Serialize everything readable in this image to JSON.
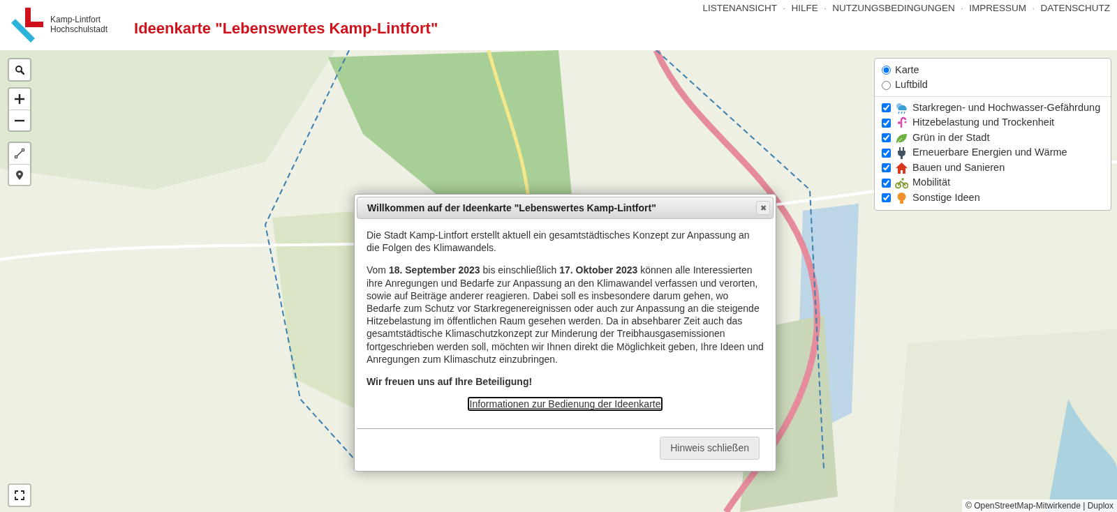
{
  "header": {
    "logo_lines": [
      "Kamp-Lintfort",
      "Hochschulstadt"
    ],
    "title": "Ideenkarte \"Lebenswertes Kamp-Lintfort\"",
    "nav": [
      {
        "kind": "link",
        "text": "LISTENANSICHT"
      },
      {
        "kind": "separator",
        "text": "·"
      },
      {
        "kind": "link",
        "text": "HILFE"
      },
      {
        "kind": "separator",
        "text": "·"
      },
      {
        "kind": "link",
        "text": "NUTZUNGSBEDINGUNGEN"
      },
      {
        "kind": "separator",
        "text": "·"
      },
      {
        "kind": "link",
        "text": "IMPRESSUM"
      },
      {
        "kind": "separator",
        "text": "·"
      },
      {
        "kind": "link",
        "text": "DATENSCHUTZ"
      }
    ]
  },
  "map": {
    "controls": [
      {
        "kind": "search"
      },
      {
        "kind": "zoom-in"
      },
      {
        "kind": "zoom-out"
      },
      {
        "kind": "line"
      },
      {
        "kind": "marker"
      },
      {
        "kind": "fullscreen"
      }
    ],
    "attribution": "© OpenStreetMap-Mitwirkende | Duplox"
  },
  "layers": {
    "base": [
      {
        "label": "Karte",
        "selected": true
      },
      {
        "label": "Luftbild",
        "selected": false
      }
    ],
    "overlays": [
      {
        "label": "Starkregen- und Hochwasser-Gefährdung",
        "checked": true,
        "kind": "rain",
        "color": "#3a9fd6"
      },
      {
        "label": "Hitzebelastung und Trockenheit",
        "checked": true,
        "kind": "heat",
        "color": "#d64ab0"
      },
      {
        "label": "Grün in der Stadt",
        "checked": true,
        "kind": "leaf",
        "color": "#6cb33f"
      },
      {
        "label": "Erneuerbare Energien und Wärme",
        "checked": true,
        "kind": "plug",
        "color": "#3f5566"
      },
      {
        "label": "Bauen und Sanieren",
        "checked": true,
        "kind": "house",
        "color": "#d9381e"
      },
      {
        "label": "Mobilität",
        "checked": true,
        "kind": "bike",
        "color": "#7a9a2a"
      },
      {
        "label": "Sonstige Ideen",
        "checked": true,
        "kind": "bulb",
        "color": "#f0922b"
      }
    ]
  },
  "dialog": {
    "title": "Willkommen auf der Ideenkarte \"Lebenswertes Kamp-Lintfort\"",
    "close": "✖",
    "paragraphs": [
      "Die Stadt Kamp-Lintfort erstellt aktuell ein gesamtstädtisches Konzept zur Anpassung an die Folgen des Klimawandels.",
      "Vom **18. September 2023** bis einschließlich **17. Oktober 2023** können alle Interessierten ihre Anregungen und Bedarfe zur Anpassung an den Klimawandel verfassen und verorten, sowie auf Beiträge anderer reagieren. Dabei soll es insbesondere darum gehen, wo Bedarfe zum Schutz vor Starkregenereignissen oder auch zur Anpassung an die steigende Hitzebelastung im öffentlichen Raum gesehen werden. Da in absehbarer Zeit auch das gesamtstädtische Klimaschutzkonzept zur Minderung der Treibhausgasemissionen fortgeschrieben werden soll, möchten wir Ihnen direkt die Möglichkeit geben, Ihre Ideen und Anregungen zum Klimaschutz einzubringen."
    ],
    "closing": "Wir freuen uns auf Ihre Beteiligung!",
    "link": "Informationen zur Bedienung der Ideenkarte",
    "button": "Hinweis schließen"
  }
}
